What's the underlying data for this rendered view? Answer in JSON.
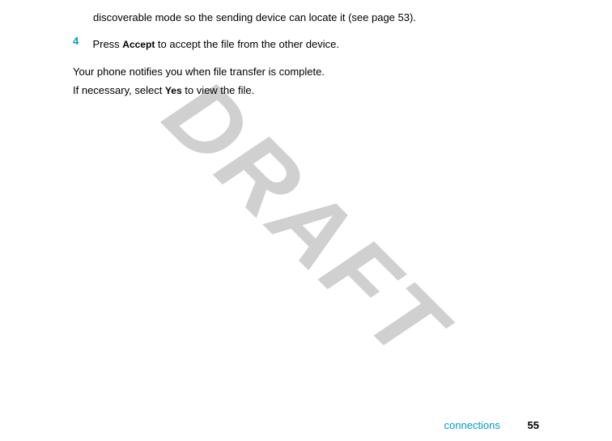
{
  "step3_partial": "discoverable mode so the sending device can locate it (see page 53).",
  "step4": {
    "number": "4",
    "text_before": "Press ",
    "bold": "Accept",
    "text_after": " to accept the file from the other device."
  },
  "body_line1": "Your phone notifies you when file transfer is complete.",
  "body_line2_before": "If necessary, select ",
  "body_line2_bold": "Yes",
  "body_line2_after": " to view the file.",
  "watermark": "DRAFT",
  "footer": {
    "section": "connections",
    "page": "55"
  }
}
